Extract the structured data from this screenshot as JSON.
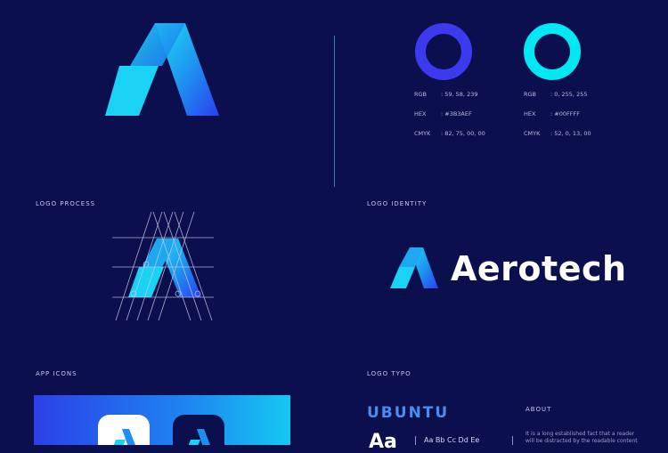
{
  "brand": {
    "name": "Aerotech"
  },
  "sections": {
    "logo_process": "LOGO PROCESS",
    "logo_identity": "LOGO IDENTITY",
    "app_icons": "APP ICONS",
    "logo_typo": "LOGO TYPO",
    "about": "ABOUT"
  },
  "colors": [
    {
      "swatch": "#3b3aef",
      "rgb_label": "RGB",
      "rgb": ": 59, 58, 239",
      "hex_label": "HEX",
      "hex": ": #3B3AEF",
      "cmyk_label": "CMYK",
      "cmyk": ": 82, 75, 00, 00"
    },
    {
      "swatch": "#00ffff",
      "rgb_label": "RGB",
      "rgb": ": 0, 255, 255",
      "hex_label": "HEX",
      "hex": ": #00FFFF",
      "cmyk_label": "CMYK",
      "cmyk": ": 52, 0, 13, 00"
    }
  ],
  "typography": {
    "font_name": "UBUNTU",
    "specimen_big": "Aa",
    "specimen_row": "Aa Bb Cc Dd Ee"
  },
  "about": {
    "text_line1": "It is a long established fact that a reader",
    "text_line2": "will be distracted by the readable content"
  }
}
